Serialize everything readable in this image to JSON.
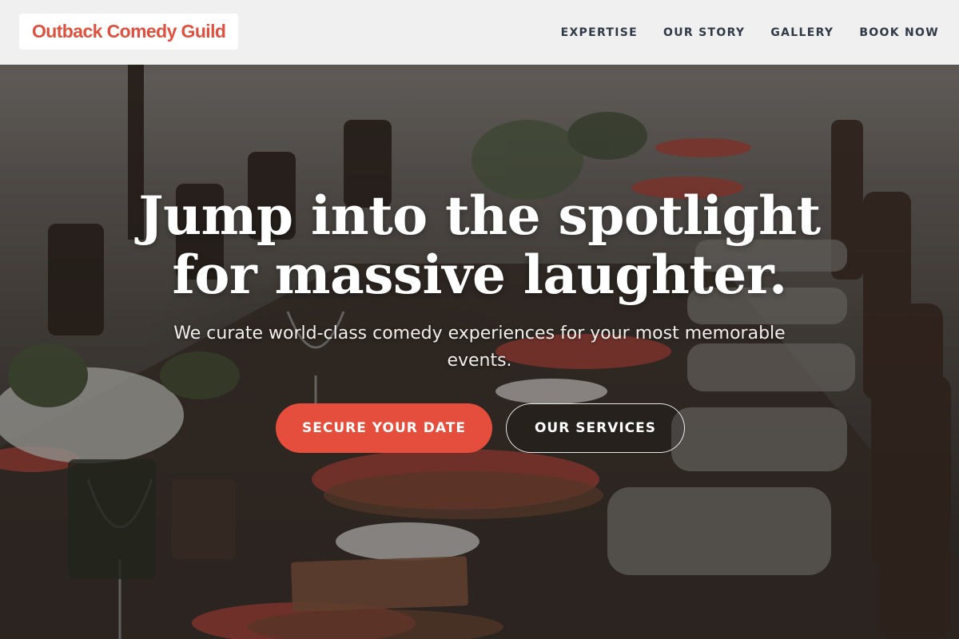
{
  "header": {
    "brand": "Outback Comedy Guild",
    "nav": [
      {
        "label": "EXPERTISE"
      },
      {
        "label": "OUR STORY"
      },
      {
        "label": "GALLERY"
      },
      {
        "label": "BOOK NOW"
      }
    ]
  },
  "hero": {
    "headline_line1": "Jump into the spotlight",
    "headline_line2": "for massive laughter.",
    "subtitle": "We curate world-class comedy experiences for your most memorable events.",
    "primary_button": "SECURE YOUR DATE",
    "secondary_button": "OUR SERVICES"
  },
  "colors": {
    "accent": "#e54e3d",
    "brand_text": "#e0503f",
    "nav_text": "#2f3a46"
  }
}
